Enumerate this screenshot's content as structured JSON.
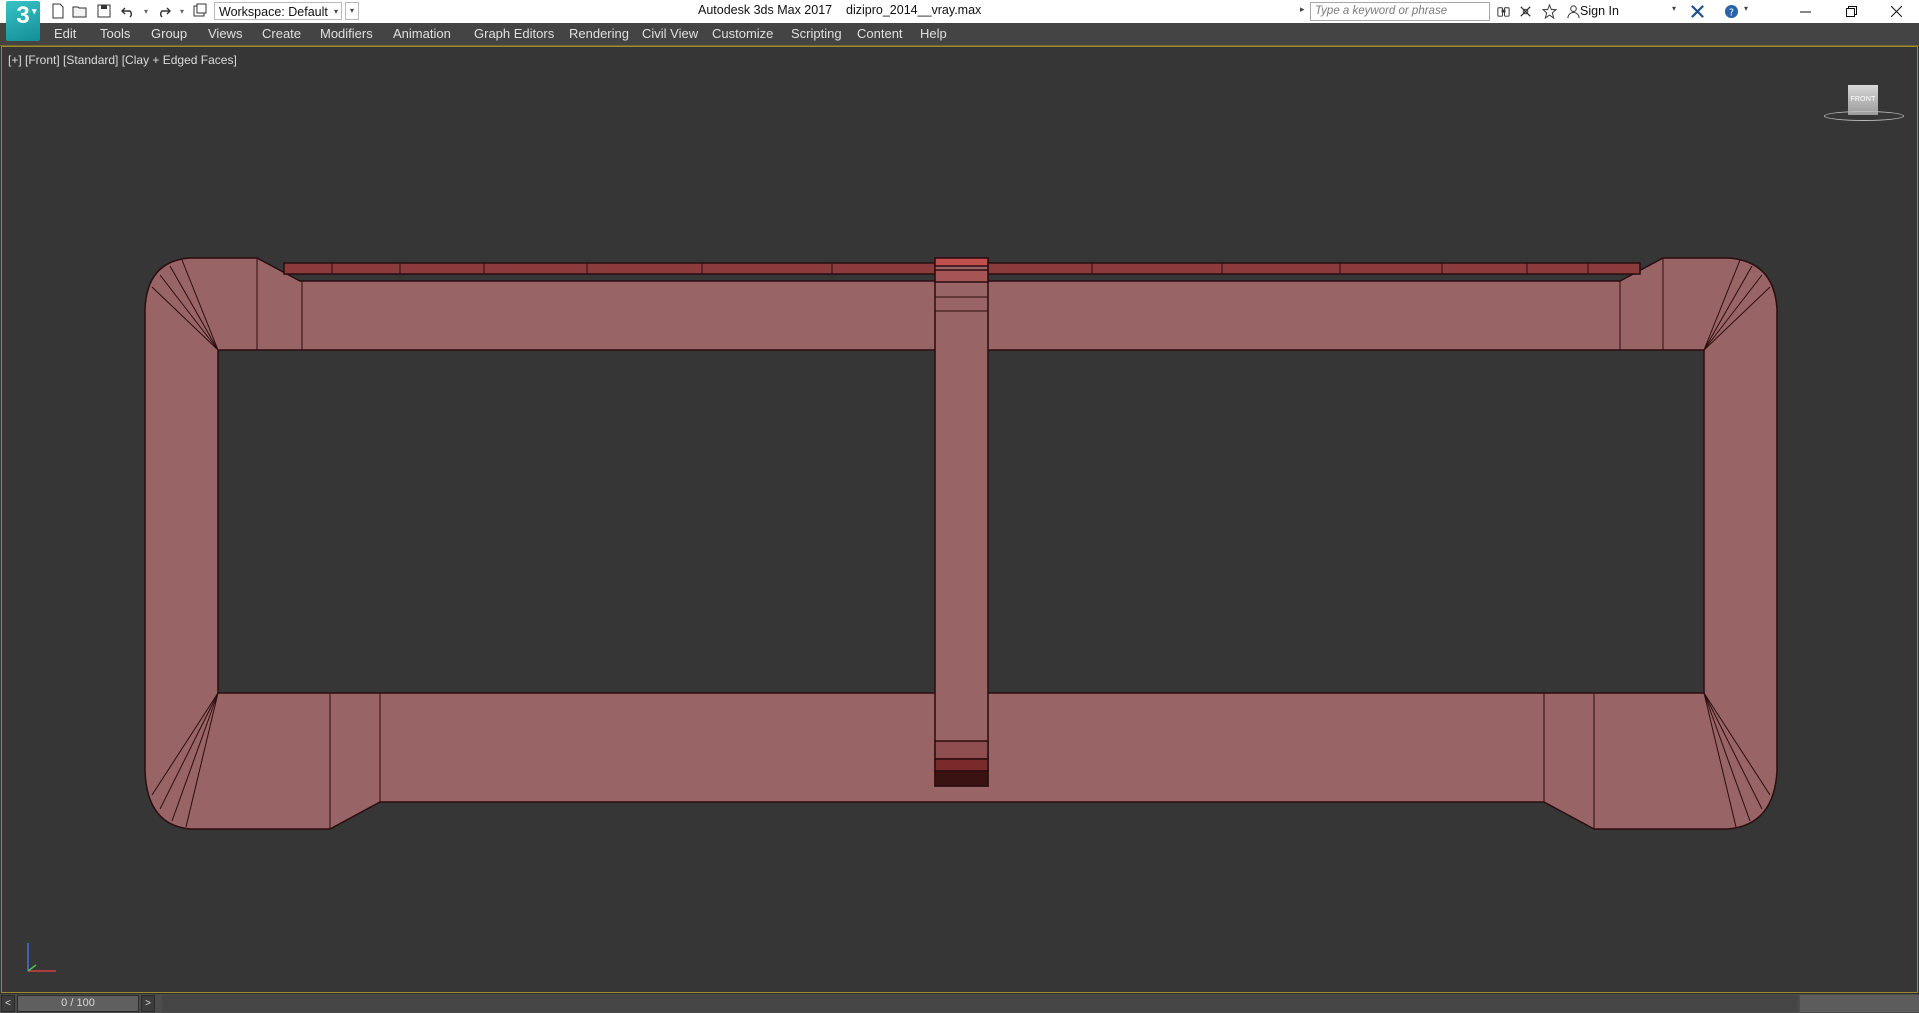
{
  "app": {
    "logo_text": "3",
    "title": "Autodesk 3ds Max 2017",
    "filename": "dizipro_2014__vray.max"
  },
  "quick_access": {
    "workspace_label": "Workspace: Default",
    "search_placeholder": "Type a keyword or phrase",
    "sign_in": "Sign In"
  },
  "menu": {
    "items": [
      "Edit",
      "Tools",
      "Group",
      "Views",
      "Create",
      "Modifiers",
      "Animation",
      "Graph Editors",
      "Rendering",
      "Civil View",
      "Customize",
      "Scripting",
      "Content",
      "Help"
    ]
  },
  "viewport": {
    "label": "[+] [Front] [Standard] [Clay + Edged Faces]",
    "viewcube_face": "FRONT",
    "model_color": "#996466",
    "edge_color": "#2a0d0f",
    "accent_color": "#c0302e"
  },
  "timeline": {
    "frame_display": "0 / 100",
    "prev": "<",
    "next": ">"
  },
  "colors": {
    "viewport_bg": "#363636",
    "menubar_bg": "#444444",
    "viewport_border": "#9c8a2e"
  }
}
